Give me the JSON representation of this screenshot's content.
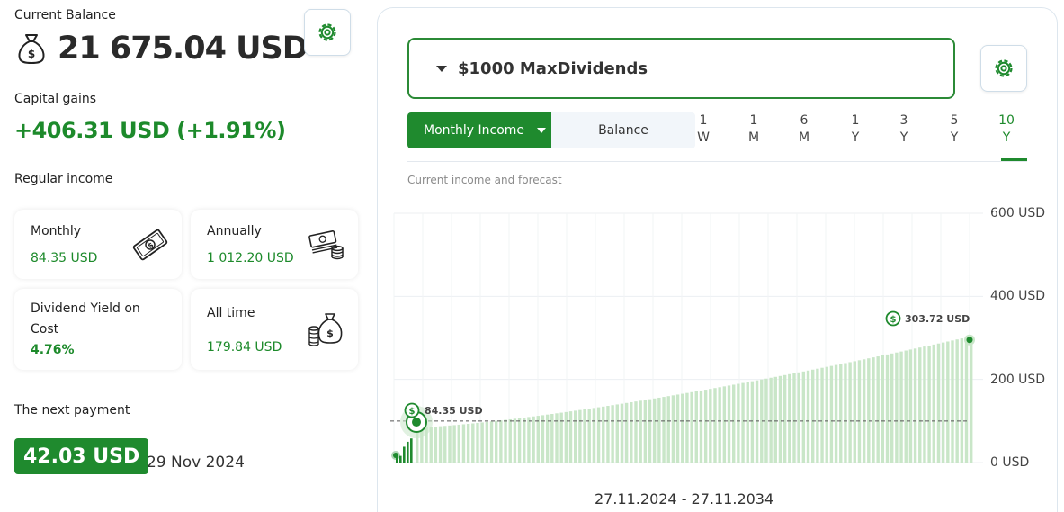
{
  "summary": {
    "balance_label": "Current Balance",
    "balance_value": "21 675.04 USD",
    "gains_label": "Capital gains",
    "gains_value": "+406.31 USD (+1.91%)",
    "regular_label": "Regular income"
  },
  "cards": {
    "monthly": {
      "title": "Monthly",
      "value": "84.35 USD"
    },
    "annually": {
      "title": "Annually",
      "value": "1 012.20 USD"
    },
    "yield": {
      "title": "Dividend Yield on Cost",
      "value": "4.76%"
    },
    "alltime": {
      "title": "All time",
      "value": "179.84 USD"
    }
  },
  "next_payment": {
    "label": "The next payment",
    "amount": "42.03 USD",
    "date": "29 Nov 2024"
  },
  "panel": {
    "portfolio_name": "$1000 MaxDividends",
    "mode_monthly": "Monthly Income",
    "mode_balance": "Balance",
    "ranges": [
      {
        "top": "1",
        "bottom": "W",
        "active": false
      },
      {
        "top": "1",
        "bottom": "M",
        "active": false
      },
      {
        "top": "6",
        "bottom": "M",
        "active": false
      },
      {
        "top": "1",
        "bottom": "Y",
        "active": false
      },
      {
        "top": "3",
        "bottom": "Y",
        "active": false
      },
      {
        "top": "5",
        "bottom": "Y",
        "active": false
      },
      {
        "top": "10",
        "bottom": "Y",
        "active": true
      }
    ],
    "chart_subtitle": "Current income and forecast",
    "date_range": "27.11.2024 - 27.11.2034"
  },
  "chart_data": {
    "type": "bar",
    "y_ticks": [
      "600 USD",
      "400 USD",
      "200 USD",
      "0 USD"
    ],
    "ylim": [
      0,
      600
    ],
    "current_value": 84.35,
    "current_label": "84.35 USD",
    "forecast_end_value": 303.72,
    "forecast_end_label": "303.72 USD",
    "reference_line": 100,
    "actual_values": [
      12,
      16,
      38,
      50,
      58
    ],
    "forecast_start": 84.35,
    "forecast_end": 303.72,
    "forecast_count": 120,
    "colors": {
      "actual": "#1f8a2e",
      "forecast": "#c9e6c8",
      "accent": "#1f8a2e"
    }
  },
  "icons": {
    "balance": "money-bag-icon",
    "monthly": "banknote-icon",
    "annually": "cash-stack-icon",
    "alltime": "coins-bag-icon",
    "settings": "gear-icon",
    "payout": "dollar-coin-icon"
  }
}
